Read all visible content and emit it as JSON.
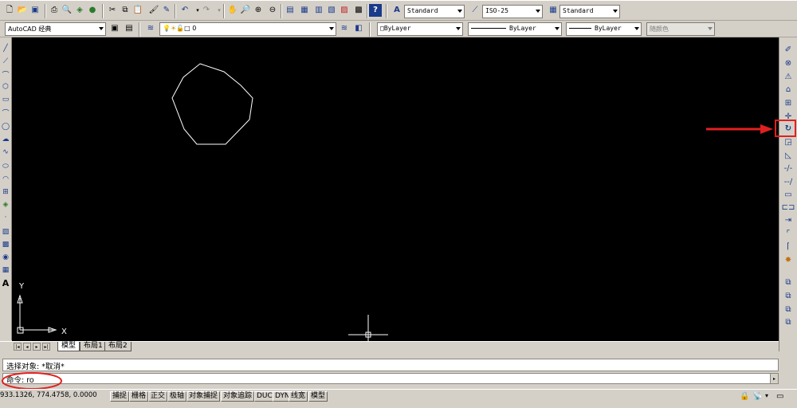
{
  "toolbar_top": {
    "text_style": "Standard",
    "dim_style": "ISO-25",
    "table_style": "Standard",
    "icons": [
      "new-icon",
      "open-icon",
      "save-icon",
      "print-icon",
      "preview-icon",
      "publish-icon",
      "3d-publish-icon",
      "cut-icon",
      "copy-icon",
      "paste-icon",
      "match-prop-icon",
      "block-editor-icon",
      "undo-icon",
      "redo-icon",
      "pan-icon",
      "zoom-realtime-icon",
      "zoom-window-icon",
      "zoom-previous-icon",
      "properties-icon",
      "design-center-icon",
      "tool-palettes-icon",
      "sheet-set-icon",
      "markup-icon",
      "calculator-icon",
      "help-icon"
    ]
  },
  "toolbar_second": {
    "workspace": "AutoCAD 经典",
    "layer": "0",
    "color": "ByLayer",
    "linetype": "ByLayer",
    "lineweight": "ByLayer",
    "plotstyle": "随颜色"
  },
  "left_toolbar_icons": [
    "line-icon",
    "construction-line-icon",
    "polyline-icon",
    "polygon-icon",
    "rectangle-icon",
    "arc-icon",
    "circle-icon",
    "revision-cloud-icon",
    "spline-icon",
    "ellipse-icon",
    "ellipse-arc-icon",
    "insert-block-icon",
    "make-block-icon",
    "point-icon",
    "hatch-icon",
    "gradient-icon",
    "region-icon",
    "table-icon",
    "multiline-text-icon"
  ],
  "right_toolbar_icons": [
    "erase-icon",
    "copy-object-icon",
    "mirror-icon",
    "offset-icon",
    "array-icon",
    "move-icon",
    "rotate-icon",
    "scale-icon",
    "stretch-icon",
    "trim-icon",
    "extend-icon",
    "break-at-point-icon",
    "break-icon",
    "join-icon",
    "chamfer-icon",
    "fillet-icon",
    "explode-icon",
    "bring-front-icon",
    "send-back-icon",
    "bring-above-icon",
    "send-under-icon"
  ],
  "canvas": {
    "ucs_y_label": "Y",
    "ucs_x_label": "X",
    "shape": "nonagon"
  },
  "tabs": [
    "模型",
    "布局1",
    "布局2"
  ],
  "command": {
    "history": "选择对象: *取消*",
    "prompt": "命令: ro"
  },
  "status": {
    "coords": "933.1326,  774.4758, 0.0000",
    "buttons": [
      "捕捉",
      "栅格",
      "正交",
      "极轴",
      "对象捕捉",
      "对象追踪",
      "DUCS",
      "DYN",
      "线宽",
      "模型"
    ]
  },
  "colors": {
    "canvas": "#000000",
    "chrome": "#d4d0c8",
    "highlight_red": "#e02020"
  }
}
